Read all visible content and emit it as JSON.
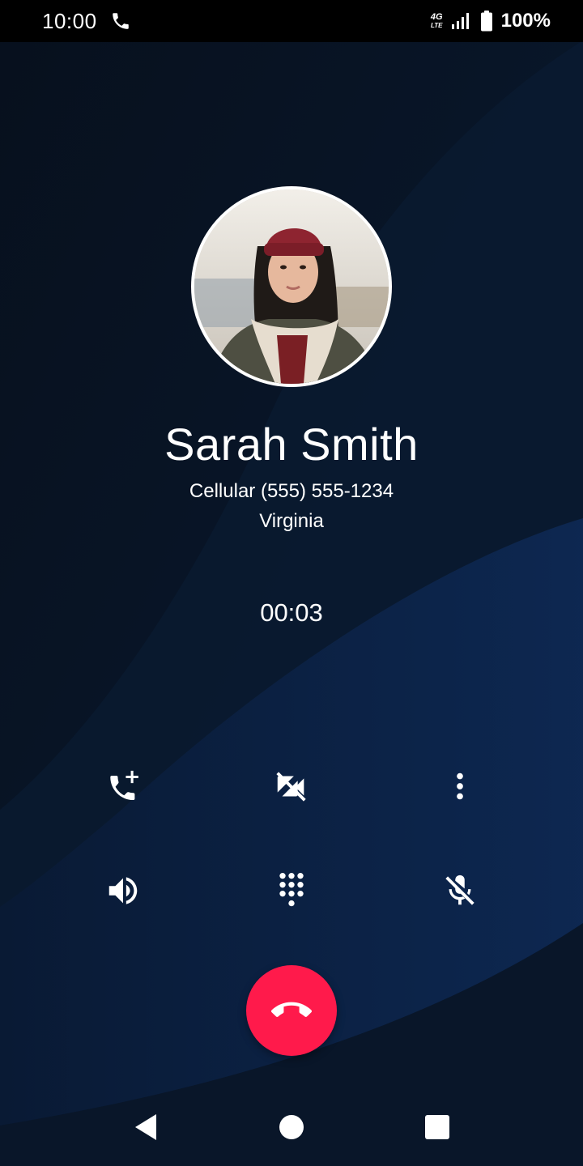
{
  "status_bar": {
    "time": "10:00",
    "network_top": "4G",
    "network_bottom": "LTE",
    "battery_percent": "100%",
    "icons": [
      "phone-call-icon",
      "signal-icon",
      "battery-icon"
    ]
  },
  "caller": {
    "name": "Sarah Smith",
    "number_line": "Cellular (555) 555-1234",
    "location": "Virginia",
    "photo_icon": "contact-photo"
  },
  "call": {
    "elapsed": "00:03"
  },
  "controls": {
    "row1": [
      "add-call-icon",
      "video-off-icon",
      "more-vert-icon"
    ],
    "row2": [
      "speaker-icon",
      "dialpad-icon",
      "mic-off-icon"
    ]
  },
  "end_call": {
    "icon": "call-end-icon",
    "color": "#ff1a4b"
  },
  "nav": {
    "icons": [
      "back-icon",
      "home-icon",
      "recents-icon"
    ]
  },
  "colors": {
    "background": "#0b1424",
    "accent_wave": "#0e2a55"
  }
}
